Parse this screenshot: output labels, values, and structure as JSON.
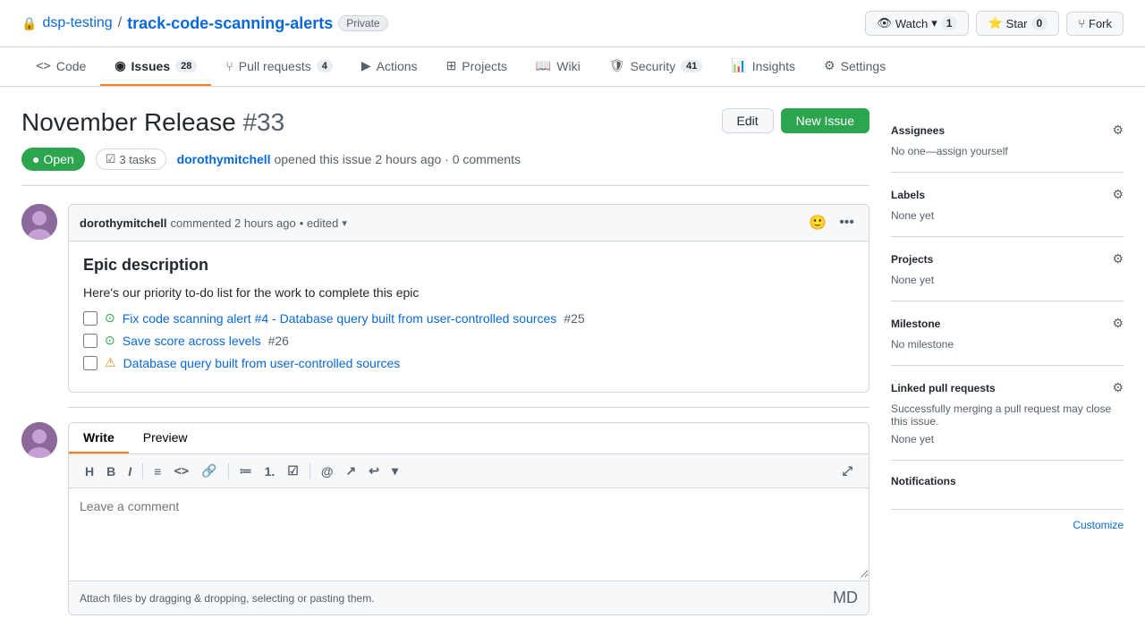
{
  "repo": {
    "owner": "dsp-testing",
    "name": "track-code-scanning-alerts",
    "visibility": "Private"
  },
  "header_actions": {
    "watch_label": "Watch",
    "watch_count": "1",
    "star_label": "Star",
    "star_count": "0",
    "fork_label": "Fork"
  },
  "nav": {
    "tabs": [
      {
        "id": "code",
        "label": "Code",
        "icon": "<>",
        "badge": null
      },
      {
        "id": "issues",
        "label": "Issues",
        "icon": "●",
        "badge": "28",
        "active": true
      },
      {
        "id": "pull-requests",
        "label": "Pull requests",
        "icon": "⑂",
        "badge": "4"
      },
      {
        "id": "actions",
        "label": "Actions",
        "icon": "▶",
        "badge": null
      },
      {
        "id": "projects",
        "label": "Projects",
        "icon": "⊞",
        "badge": null
      },
      {
        "id": "wiki",
        "label": "Wiki",
        "icon": "📖",
        "badge": null
      },
      {
        "id": "security",
        "label": "Security",
        "icon": "🛡",
        "badge": "41"
      },
      {
        "id": "insights",
        "label": "Insights",
        "icon": "📊",
        "badge": null
      },
      {
        "id": "settings",
        "label": "Settings",
        "icon": "⚙",
        "badge": null
      }
    ]
  },
  "issue": {
    "title": "November Release",
    "number": "#33",
    "status": "Open",
    "tasks": "3 tasks",
    "author": "dorothymitchell",
    "opened_text": "opened this issue 2 hours ago · 0 comments"
  },
  "buttons": {
    "edit": "Edit",
    "new_issue": "New Issue"
  },
  "comment": {
    "author": "dorothymitchell",
    "action": "commented 2 hours ago",
    "edited_label": "• edited",
    "heading": "Epic description",
    "intro": "Here's our priority to-do list for the work to complete this epic",
    "tasks": [
      {
        "id": 1,
        "checked": false,
        "icon_type": "in-progress",
        "link_text": "Fix code scanning alert #4 - Database query built from user-controlled sources",
        "link_href": "#",
        "issue_num": "#25"
      },
      {
        "id": 2,
        "checked": false,
        "icon_type": "in-progress",
        "link_text": "Save score across levels",
        "link_href": "#",
        "issue_num": "#26"
      },
      {
        "id": 3,
        "checked": false,
        "icon_type": "alert",
        "link_text": "Database query built from user-controlled sources",
        "link_href": "#",
        "issue_num": ""
      }
    ]
  },
  "write_area": {
    "write_tab": "Write",
    "preview_tab": "Preview",
    "placeholder": "Leave a comment",
    "footer_text": "Attach files by dragging & dropping, selecting or pasting them."
  },
  "toolbar": {
    "buttons": [
      "H",
      "B",
      "I",
      "≡",
      "<>",
      "🔗",
      "≔",
      "1.",
      "☑",
      "@",
      "↗",
      "↩"
    ]
  },
  "sidebar": {
    "assignees": {
      "title": "Assignees",
      "value": "No one—assign yourself"
    },
    "labels": {
      "title": "Labels",
      "value": "None yet"
    },
    "projects": {
      "title": "Projects",
      "value": "None yet"
    },
    "milestone": {
      "title": "Milestone",
      "value": "No milestone"
    },
    "linked_prs": {
      "title": "Linked pull requests",
      "description": "Successfully merging a pull request may close this issue.",
      "value": "None yet"
    },
    "notifications": {
      "title": "Notifications"
    },
    "customize_label": "Customize"
  }
}
